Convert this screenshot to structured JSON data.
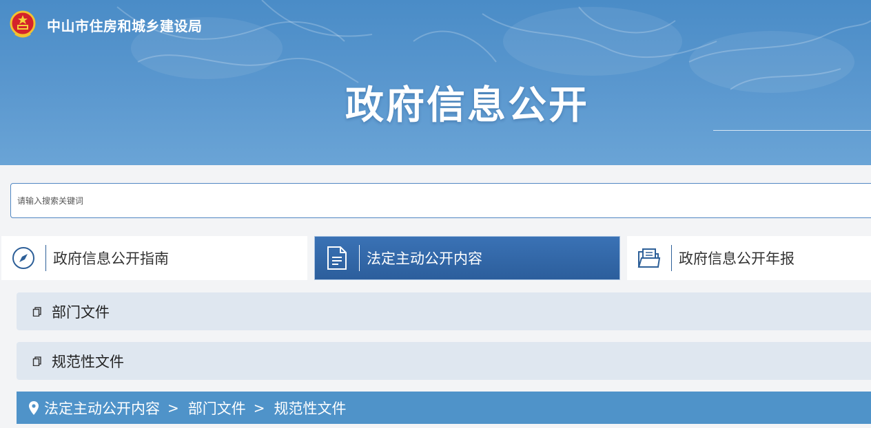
{
  "header": {
    "site_name": "中山市住房和城乡建设局",
    "banner_title": "政府信息公开"
  },
  "search": {
    "placeholder": "请输入搜索关键词"
  },
  "tabs": [
    {
      "label": "政府信息公开指南",
      "icon": "compass-icon",
      "active": false
    },
    {
      "label": "法定主动公开内容",
      "icon": "document-icon",
      "active": true
    },
    {
      "label": "政府信息公开年报",
      "icon": "folder-icon",
      "active": false
    }
  ],
  "categories": [
    {
      "label": "部门文件"
    },
    {
      "label": "规范性文件"
    }
  ],
  "breadcrumb": {
    "items": [
      "法定主动公开内容",
      "部门文件",
      "规范性文件"
    ],
    "separator": ">"
  },
  "colors": {
    "brand_blue": "#2c5e9c",
    "banner_blue": "#5b98cf",
    "breadcrumb_blue": "#4f93c9",
    "list_bg": "#dfe7f0"
  }
}
